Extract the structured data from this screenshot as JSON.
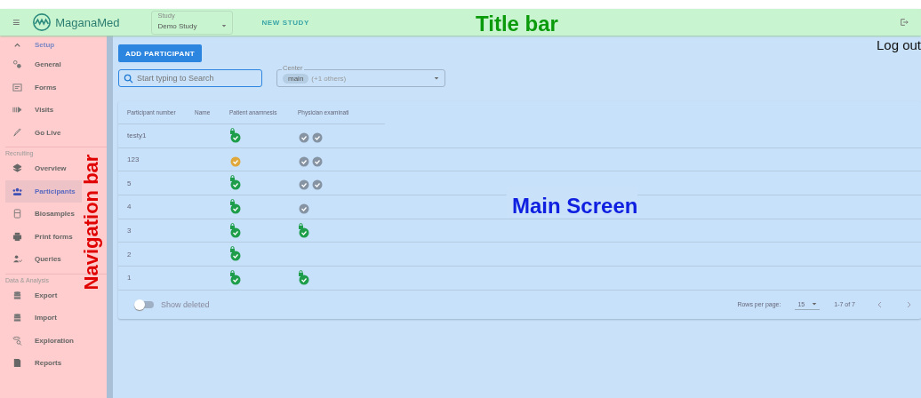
{
  "title_bar": {
    "menu": "≡",
    "logo": "MaganaMed",
    "study_select": {
      "label": "Study",
      "value": "Demo Study"
    },
    "new_study": "NEW STUDY"
  },
  "sidebar": {
    "sections": [
      {
        "heading": "Setup",
        "expanded": true,
        "items": [
          {
            "label": "General",
            "selected": false
          },
          {
            "label": "Forms",
            "selected": false
          },
          {
            "label": "Visits",
            "selected": false
          },
          {
            "label": "Go Live",
            "selected": false
          }
        ]
      },
      {
        "heading": "Recruiting",
        "items": [
          {
            "label": "Overview",
            "selected": false
          },
          {
            "label": "Participants",
            "selected": true
          },
          {
            "label": "Biosamples",
            "selected": false
          },
          {
            "label": "Print forms",
            "selected": false
          },
          {
            "label": "Queries",
            "selected": false
          }
        ]
      },
      {
        "heading": "Data & Analysis",
        "items": [
          {
            "label": "Export",
            "selected": false
          },
          {
            "label": "Import",
            "selected": false
          },
          {
            "label": "Exploration",
            "selected": false
          },
          {
            "label": "Reports",
            "selected": false
          }
        ]
      }
    ]
  },
  "main": {
    "add_button": "ADD PARTICIPANT",
    "search": {
      "placeholder": "Start typing to Search"
    },
    "center_filter": {
      "label": "Center",
      "chip": "main",
      "extra": "(+1 others)"
    },
    "table": {
      "columns": [
        "Participant number",
        "Name",
        "Patient anamnesis",
        "Physician examinati"
      ],
      "rows": [
        {
          "participant_number": "testy1",
          "patient_anamnesis": [
            {
              "kind": "locked"
            }
          ],
          "physician_examination": [
            {
              "kind": "done"
            },
            {
              "kind": "done"
            }
          ]
        },
        {
          "participant_number": "123",
          "patient_anamnesis": [
            {
              "kind": "warning"
            }
          ],
          "physician_examination": [
            {
              "kind": "done"
            },
            {
              "kind": "done"
            }
          ]
        },
        {
          "participant_number": "5",
          "patient_anamnesis": [
            {
              "kind": "locked"
            }
          ],
          "physician_examination": [
            {
              "kind": "done"
            },
            {
              "kind": "done"
            }
          ]
        },
        {
          "participant_number": "4",
          "patient_anamnesis": [
            {
              "kind": "locked"
            }
          ],
          "physician_examination": [
            {
              "kind": "done"
            }
          ]
        },
        {
          "participant_number": "3",
          "patient_anamnesis": [
            {
              "kind": "locked"
            }
          ],
          "physician_examination": [
            {
              "kind": "locked"
            }
          ]
        },
        {
          "participant_number": "2",
          "patient_anamnesis": [
            {
              "kind": "locked"
            }
          ]
        },
        {
          "participant_number": "1",
          "patient_anamnesis": [
            {
              "kind": "locked"
            }
          ],
          "physician_examination": [
            {
              "kind": "locked"
            }
          ]
        }
      ]
    },
    "show_deleted": {
      "label": "Show deleted",
      "on": false
    },
    "pagination": {
      "rows_per_page_label": "Rows per page:",
      "rows_per_page": "15",
      "range": "1-7 of 7"
    }
  },
  "annotations": [
    {
      "kind": "title",
      "text": "Title bar"
    },
    {
      "kind": "logout",
      "text": "Log out"
    },
    {
      "kind": "nav",
      "text": "Navigation bar"
    },
    {
      "kind": "main",
      "text": "Main Screen"
    }
  ]
}
